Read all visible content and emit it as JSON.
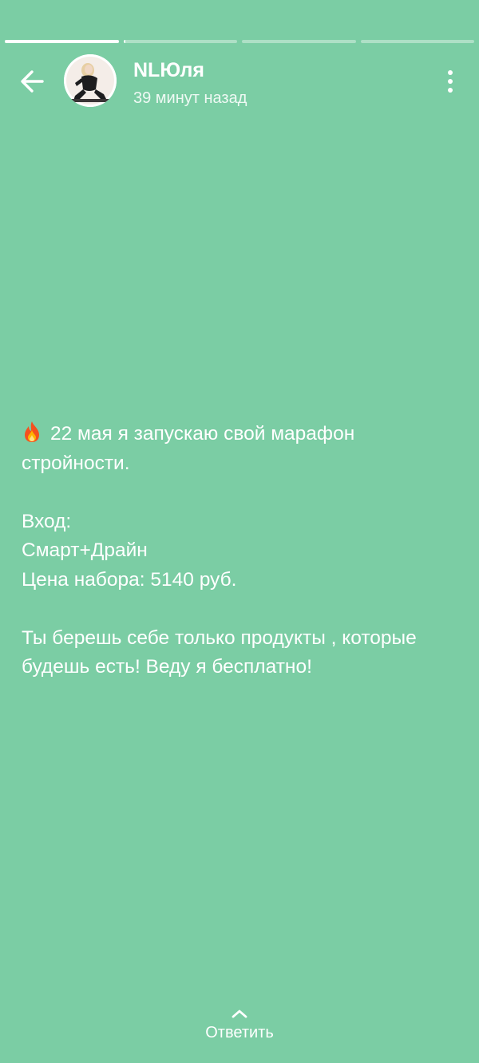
{
  "story": {
    "progress": {
      "total_segments": 4,
      "current_index": 1,
      "segment_fill": [
        1.0,
        0.02,
        0.0,
        0.0
      ]
    },
    "author": {
      "name": "NLЮля",
      "time_ago": "39 минут назад"
    },
    "post": {
      "lines": [
        "22 мая я запускаю свой марафон",
        "стройности.",
        "",
        "Вход:",
        "Смарт+Драйн",
        "Цена набора: 5140 руб.",
        "",
        "Ты берешь себе только продукты , которые",
        "будешь есть! Веду я бесплатно!"
      ]
    },
    "reply": {
      "label": "Ответить"
    }
  },
  "icons": {
    "back": "arrow-left-icon",
    "menu": "more-vertical-icon",
    "reply": "chevron-up-icon",
    "fire": "fire-emoji-icon"
  },
  "colors": {
    "background": "#7bcda4",
    "foreground": "#ffffff"
  }
}
